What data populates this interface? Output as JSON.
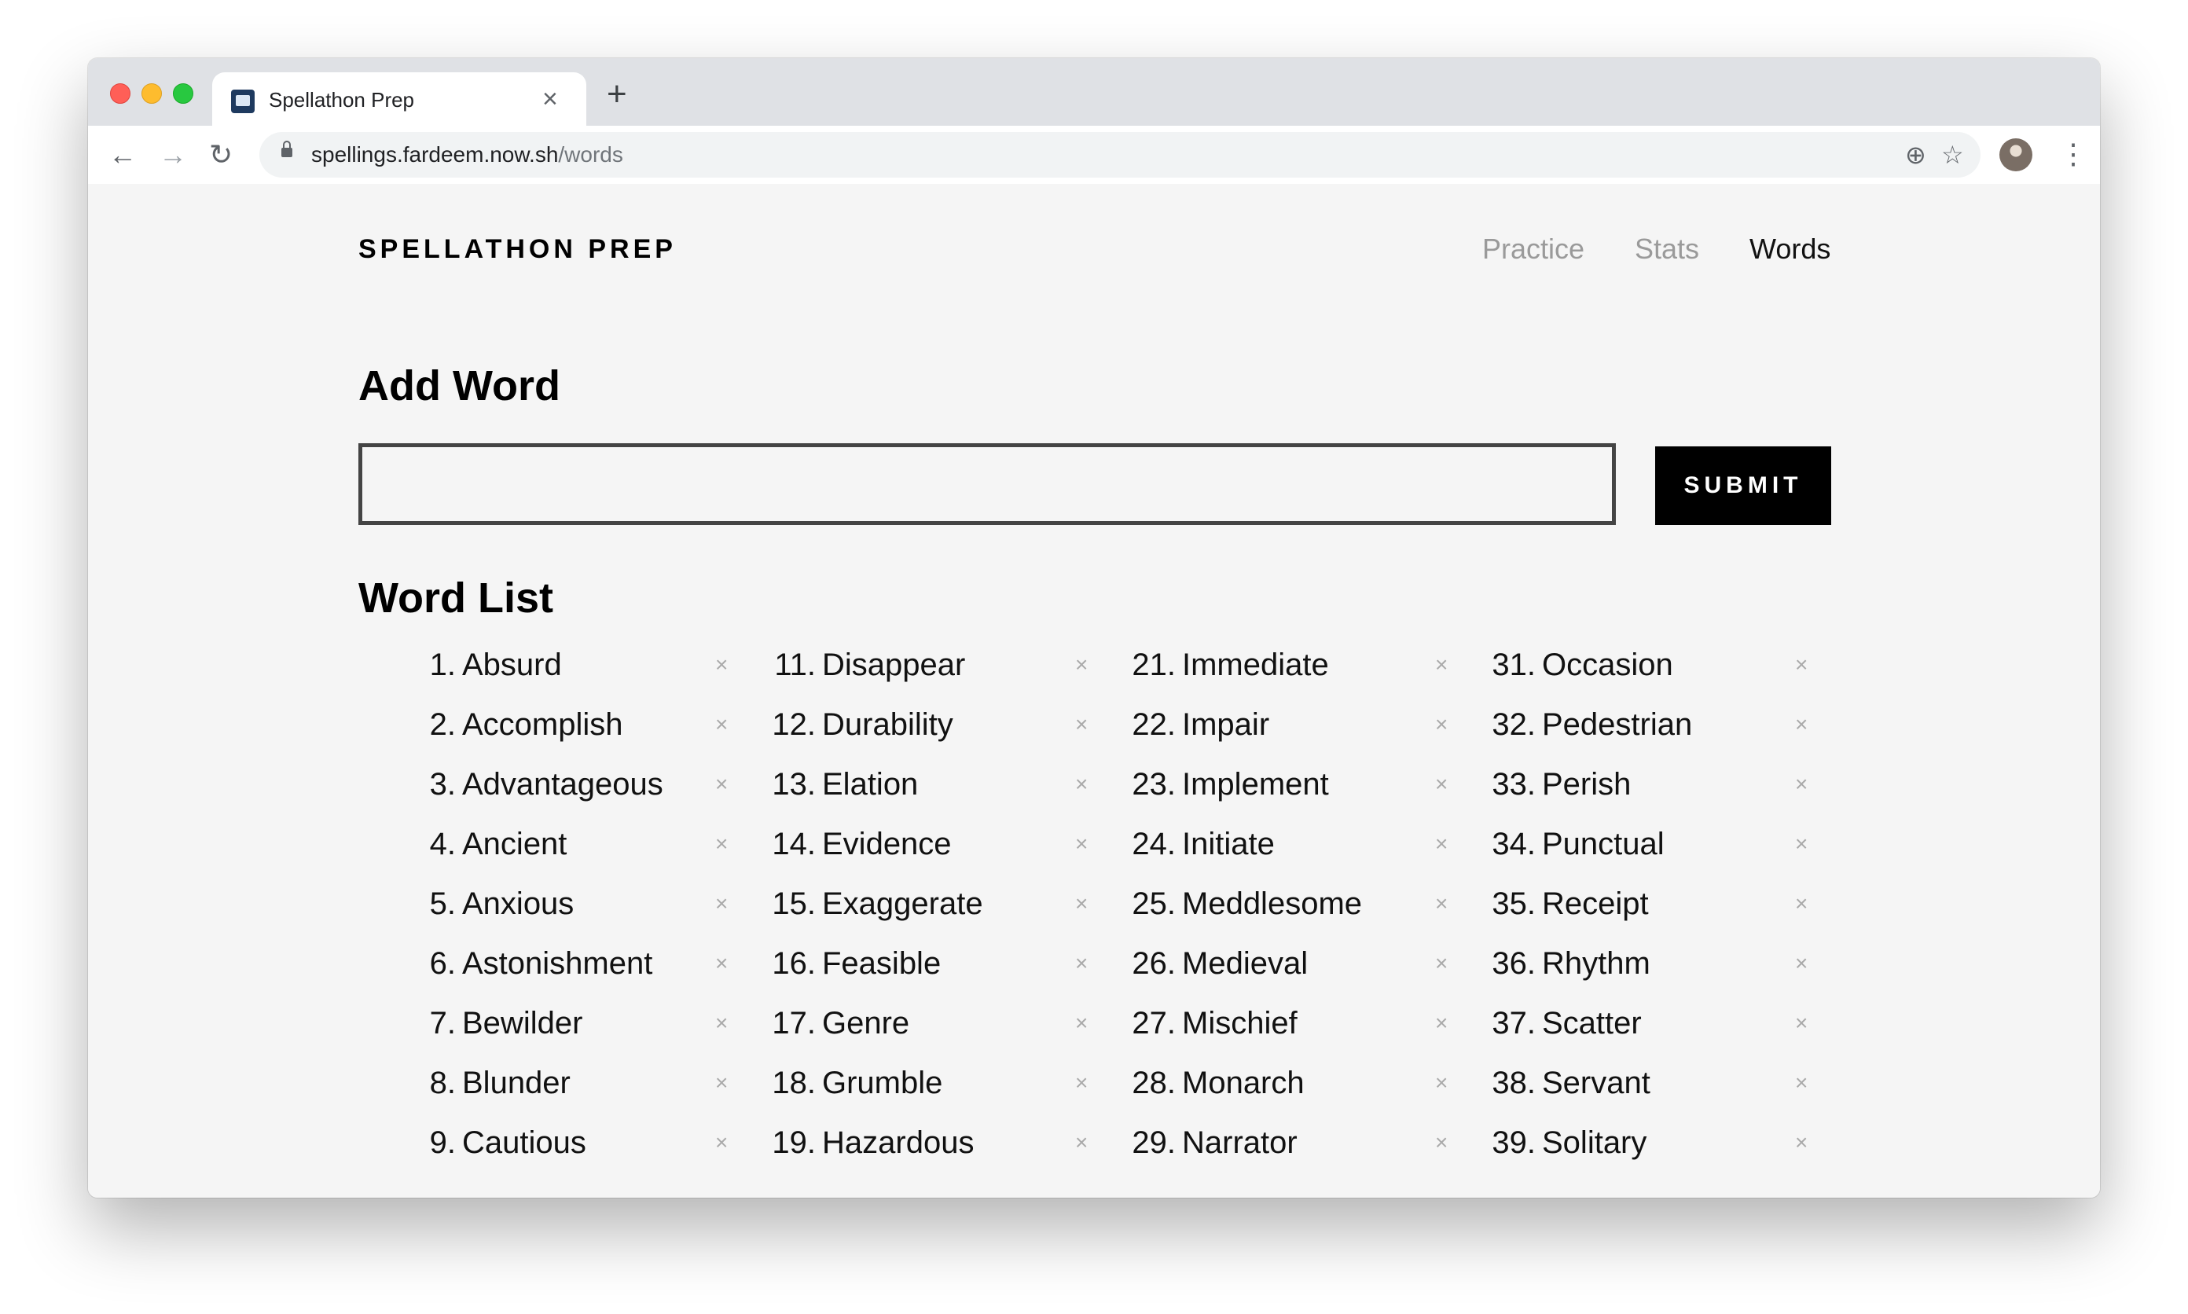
{
  "browser": {
    "tab_title": "Spellathon Prep",
    "tab_close": "×",
    "new_tab": "+",
    "url_host": "spellings.fardeem.now.sh",
    "url_path": "/words",
    "back": "←",
    "forward": "→",
    "reload": "↻",
    "zoom_icon": "⊕",
    "star_icon": "☆",
    "menu": "⋮"
  },
  "app": {
    "brand": "SPELLATHON PREP",
    "nav": {
      "practice": "Practice",
      "stats": "Stats",
      "words": "Words"
    },
    "add_word_heading": "Add Word",
    "word_input": {
      "value": "",
      "placeholder": ""
    },
    "submit_label": "SUBMIT",
    "word_list_heading": "Word List",
    "delete_glyph": "×",
    "columns": [
      [
        {
          "num": "1.",
          "word": "Absurd"
        },
        {
          "num": "2.",
          "word": "Accomplish"
        },
        {
          "num": "3.",
          "word": "Advantageous"
        },
        {
          "num": "4.",
          "word": "Ancient"
        },
        {
          "num": "5.",
          "word": "Anxious"
        },
        {
          "num": "6.",
          "word": "Astonishment"
        },
        {
          "num": "7.",
          "word": "Bewilder"
        },
        {
          "num": "8.",
          "word": "Blunder"
        },
        {
          "num": "9.",
          "word": "Cautious"
        }
      ],
      [
        {
          "num": "11.",
          "word": "Disappear"
        },
        {
          "num": "12.",
          "word": "Durability"
        },
        {
          "num": "13.",
          "word": "Elation"
        },
        {
          "num": "14.",
          "word": "Evidence"
        },
        {
          "num": "15.",
          "word": "Exaggerate"
        },
        {
          "num": "16.",
          "word": "Feasible"
        },
        {
          "num": "17.",
          "word": "Genre"
        },
        {
          "num": "18.",
          "word": "Grumble"
        },
        {
          "num": "19.",
          "word": "Hazardous"
        }
      ],
      [
        {
          "num": "21.",
          "word": "Immediate"
        },
        {
          "num": "22.",
          "word": "Impair"
        },
        {
          "num": "23.",
          "word": "Implement"
        },
        {
          "num": "24.",
          "word": "Initiate"
        },
        {
          "num": "25.",
          "word": "Meddlesome"
        },
        {
          "num": "26.",
          "word": "Medieval"
        },
        {
          "num": "27.",
          "word": "Mischief"
        },
        {
          "num": "28.",
          "word": "Monarch"
        },
        {
          "num": "29.",
          "word": "Narrator"
        }
      ],
      [
        {
          "num": "31.",
          "word": "Occasion"
        },
        {
          "num": "32.",
          "word": "Pedestrian"
        },
        {
          "num": "33.",
          "word": "Perish"
        },
        {
          "num": "34.",
          "word": "Punctual"
        },
        {
          "num": "35.",
          "word": "Receipt"
        },
        {
          "num": "36.",
          "word": "Rhythm"
        },
        {
          "num": "37.",
          "word": "Scatter"
        },
        {
          "num": "38.",
          "word": "Servant"
        },
        {
          "num": "39.",
          "word": "Solitary"
        }
      ]
    ]
  }
}
